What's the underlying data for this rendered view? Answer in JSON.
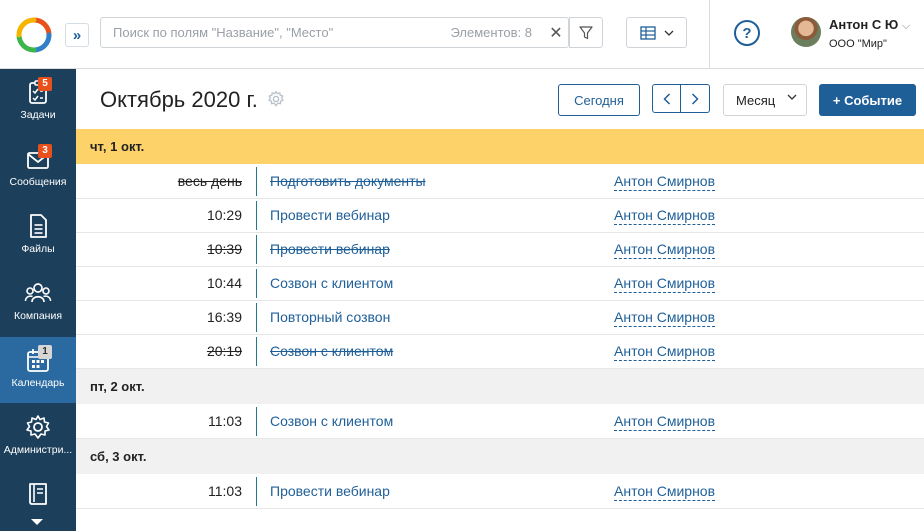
{
  "header": {
    "search": {
      "placeholder": "Поиск по полям \"Название\", \"Место\"",
      "value": "",
      "count_label": "Элементов: 8"
    },
    "clear_icon": "close-icon",
    "filter_icon": "filter-icon",
    "view_icon": "table-view-icon",
    "help_label": "?",
    "user": {
      "name": "Антон С Ю",
      "org": "ООО \"Мир\""
    }
  },
  "sidebar": {
    "items": [
      {
        "id": "tasks",
        "label": "Задачи",
        "icon": "tasks-icon",
        "badge": "5",
        "active": false
      },
      {
        "id": "messages",
        "label": "Сообщения",
        "icon": "envelope-icon",
        "badge": "3",
        "active": false
      },
      {
        "id": "files",
        "label": "Файлы",
        "icon": "file-icon",
        "badge": "",
        "active": false
      },
      {
        "id": "company",
        "label": "Компания",
        "icon": "people-icon",
        "badge": "",
        "active": false
      },
      {
        "id": "calendar",
        "label": "Календарь",
        "icon": "calendar-icon",
        "badge": "1",
        "active": true
      },
      {
        "id": "admin",
        "label": "Администри...",
        "icon": "gear-icon",
        "badge": "",
        "active": false
      },
      {
        "id": "docs",
        "label": "",
        "icon": "book-icon",
        "badge": "",
        "active": false
      }
    ]
  },
  "main": {
    "title": "Октябрь 2020 г.",
    "today_label": "Сегодня",
    "period": "Месяц",
    "add_event_label": "+ Событие",
    "days": [
      {
        "label": "чт, 1 окт.",
        "today": true,
        "events": [
          {
            "time": "весь день",
            "title": "Подготовить документы",
            "owner": "Антон Смирнов",
            "done": true
          },
          {
            "time": "10:29",
            "title": "Провести вебинар",
            "owner": "Антон Смирнов",
            "done": false
          },
          {
            "time": "10:39",
            "title": "Провести вебинар",
            "owner": "Антон Смирнов",
            "done": true
          },
          {
            "time": "10:44",
            "title": "Созвон с клиентом",
            "owner": "Антон Смирнов",
            "done": false
          },
          {
            "time": "16:39",
            "title": "Повторный созвон",
            "owner": "Антон Смирнов",
            "done": false
          },
          {
            "time": "20:19",
            "title": "Созвон с клиентом",
            "owner": "Антон Смирнов",
            "done": true
          }
        ]
      },
      {
        "label": "пт, 2 окт.",
        "today": false,
        "events": [
          {
            "time": "11:03",
            "title": "Созвон с клиентом",
            "owner": "Антон Смирнов",
            "done": false
          }
        ]
      },
      {
        "label": "сб, 3 окт.",
        "today": false,
        "events": [
          {
            "time": "11:03",
            "title": "Провести вебинар",
            "owner": "Антон Смирнов",
            "done": false
          }
        ]
      }
    ]
  },
  "colors": {
    "primary": "#1f5f98",
    "sidebar": "#1c3f5b",
    "sidebar_active": "#2a6aa0",
    "today_header": "#fcd269",
    "badge": "#e8501c"
  }
}
